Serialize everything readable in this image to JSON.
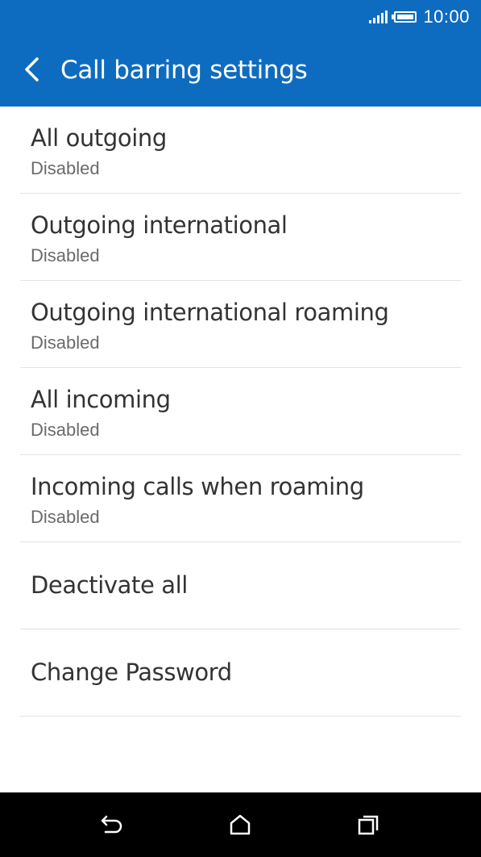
{
  "status_bar": {
    "time": "10:00",
    "signal_icon": "signal-icon",
    "battery_icon": "battery-icon"
  },
  "app_bar": {
    "back_icon": "chevron-left-icon",
    "title": "Call barring settings"
  },
  "items": [
    {
      "title": "All outgoing",
      "subtitle": "Disabled"
    },
    {
      "title": "Outgoing international",
      "subtitle": "Disabled"
    },
    {
      "title": "Outgoing international roaming",
      "subtitle": "Disabled"
    },
    {
      "title": "All incoming",
      "subtitle": "Disabled"
    },
    {
      "title": "Incoming calls when roaming",
      "subtitle": "Disabled"
    },
    {
      "title": "Deactivate all"
    },
    {
      "title": "Change Password"
    }
  ],
  "nav_bar": {
    "back_icon": "back-arrow-icon",
    "home_icon": "home-icon",
    "recents_icon": "recents-icon"
  },
  "colors": {
    "primary": "#0e6cc0",
    "text_primary": "#333333",
    "text_secondary": "#6a6a6a",
    "divider": "#e3e3e3",
    "nav_background": "#000000"
  }
}
